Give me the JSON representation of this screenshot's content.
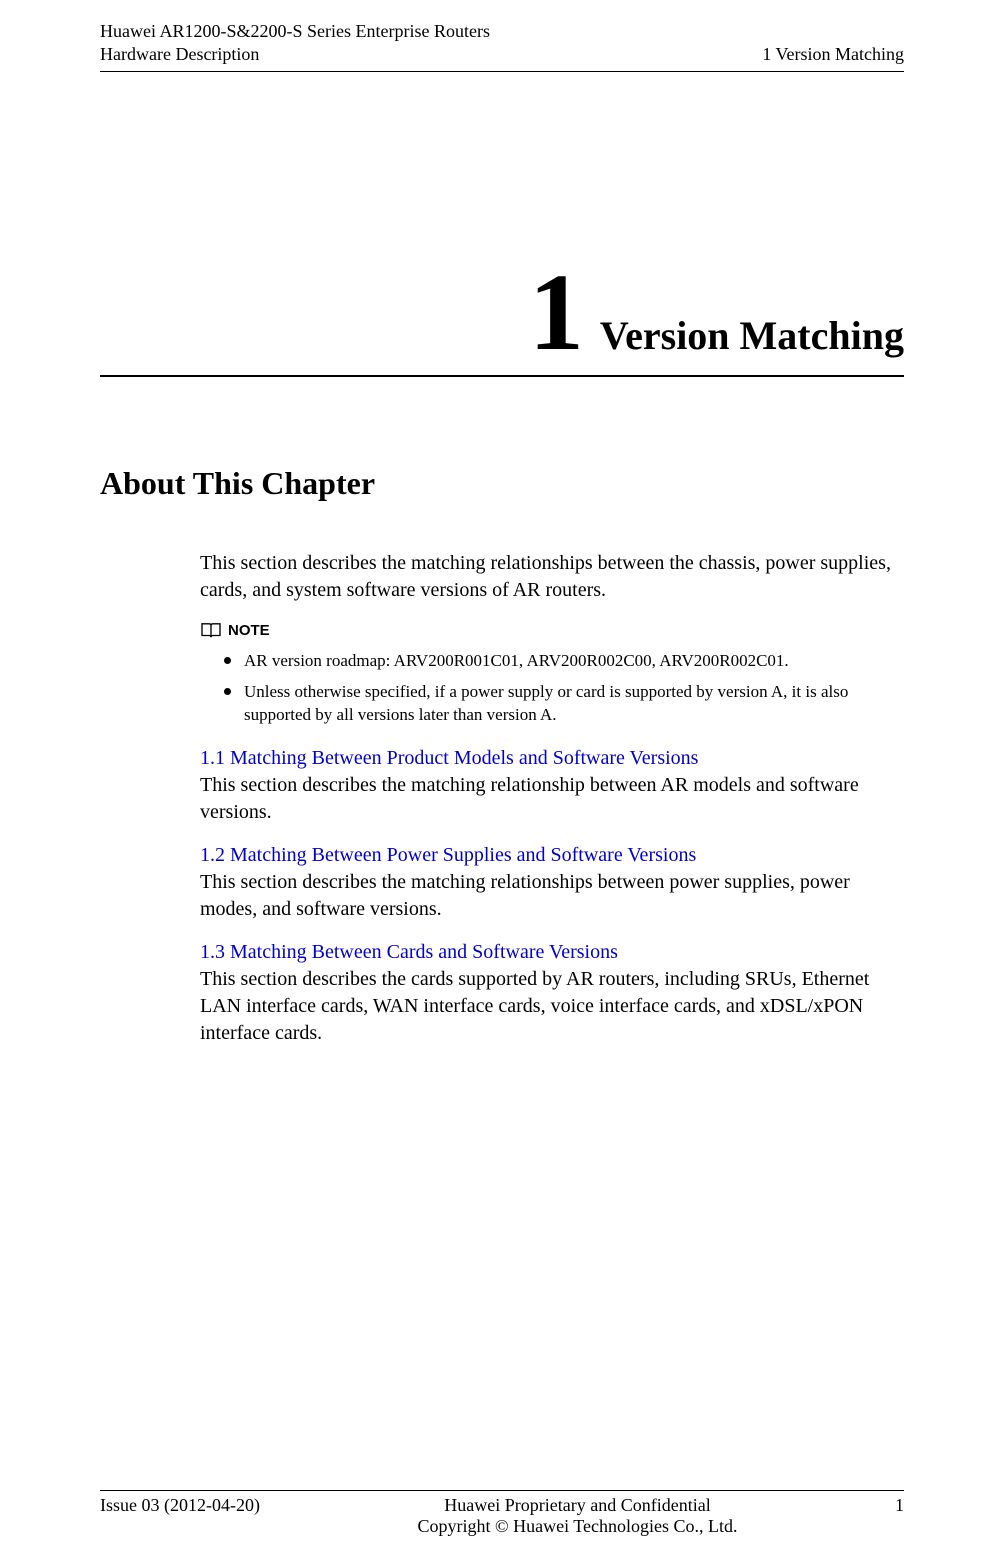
{
  "header": {
    "line1": "Huawei AR1200-S&2200-S Series Enterprise Routers",
    "line2": "Hardware Description",
    "right": "1 Version Matching"
  },
  "chapter": {
    "number": "1",
    "title": "Version Matching"
  },
  "section_heading": "About This Chapter",
  "intro": "This section describes the matching relationships between the chassis, power supplies, cards, and system software versions of AR routers.",
  "note": {
    "label": "NOTE",
    "items": [
      "AR version roadmap: ARV200R001C01, ARV200R002C00, ARV200R002C01.",
      "Unless otherwise specified, if a power supply or card is supported by version A, it is also supported by all versions later than version A."
    ]
  },
  "toc": [
    {
      "link": "1.1 Matching Between Product Models and Software Versions",
      "desc": "This section describes the matching relationship between AR models and software versions."
    },
    {
      "link": "1.2 Matching Between Power Supplies and Software Versions",
      "desc": "This section describes the matching relationships between power supplies, power modes, and software versions."
    },
    {
      "link": "1.3 Matching Between Cards and Software Versions",
      "desc": "This section describes the cards supported by AR routers, including SRUs, Ethernet LAN interface cards, WAN interface cards, voice interface cards, and xDSL/xPON interface cards."
    }
  ],
  "footer": {
    "left": "Issue 03 (2012-04-20)",
    "center_line1": "Huawei Proprietary and Confidential",
    "center_line2": "Copyright © Huawei Technologies Co., Ltd.",
    "right": "1"
  }
}
